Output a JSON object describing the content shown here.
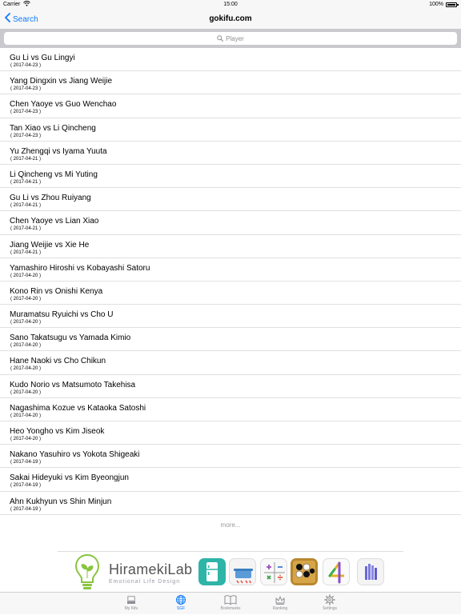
{
  "status": {
    "carrier": "Carrier",
    "time": "15:00",
    "battery": "100%"
  },
  "nav": {
    "back_label": "Search",
    "title": "gokifu.com"
  },
  "search": {
    "placeholder": "Player"
  },
  "games": [
    {
      "title": "Gu Li vs Gu Lingyi",
      "date": "( 2017-04-23 )"
    },
    {
      "title": "Yang Dingxin vs Jiang Weijie",
      "date": "( 2017-04-23 )"
    },
    {
      "title": "Chen Yaoye vs Guo Wenchao",
      "date": "( 2017-04-23 )"
    },
    {
      "title": "Tan Xiao vs Li Qincheng",
      "date": "( 2017-04-23 )"
    },
    {
      "title": "Yu Zhengqi vs Iyama Yuuta",
      "date": "( 2017-04-21 )"
    },
    {
      "title": "Li Qincheng vs Mi Yuting",
      "date": "( 2017-04-21 )"
    },
    {
      "title": "Gu Li vs Zhou Ruiyang",
      "date": "( 2017-04-21 )"
    },
    {
      "title": "Chen Yaoye vs Lian Xiao",
      "date": "( 2017-04-21 )"
    },
    {
      "title": "Jiang Weijie vs Xie He",
      "date": "( 2017-04-21 )"
    },
    {
      "title": "Yamashiro Hiroshi vs Kobayashi Satoru",
      "date": "( 2017-04-20 )"
    },
    {
      "title": "Kono Rin vs Onishi Kenya",
      "date": "( 2017-04-20 )"
    },
    {
      "title": "Muramatsu Ryuichi vs Cho U",
      "date": "( 2017-04-20 )"
    },
    {
      "title": "Sano Takatsugu vs Yamada Kimio",
      "date": "( 2017-04-20 )"
    },
    {
      "title": "Hane Naoki vs Cho Chikun",
      "date": "( 2017-04-20 )"
    },
    {
      "title": "Kudo Norio vs Matsumoto Takehisa",
      "date": "( 2017-04-20 )"
    },
    {
      "title": "Nagashima Kozue vs Kataoka Satoshi",
      "date": "( 2017-04-20 )"
    },
    {
      "title": "Heo Yongho vs Kim Jiseok",
      "date": "( 2017-04-20 )"
    },
    {
      "title": "Nakano Yasuhiro vs Yokota Shigeaki",
      "date": "( 2017-04-19 )"
    },
    {
      "title": "Sakai Hideyuki vs Kim Byeongjun",
      "date": "( 2017-04-19 )"
    },
    {
      "title": "Ahn Kukhyun vs Shin Minjun",
      "date": "( 2017-04-19 )"
    }
  ],
  "more_label": "more...",
  "ad": {
    "brand": "HiramekiLab",
    "tagline": "Emotional Life Design",
    "icons": [
      "fridge-app-icon",
      "pot-app-icon",
      "calculator-app-icon",
      "go-board-app-icon",
      "number-four-app-icon",
      "bars-app-icon"
    ]
  },
  "tabs": [
    {
      "label": "My Kifu",
      "icon": "inbox-icon"
    },
    {
      "label": "SGF",
      "icon": "globe-icon"
    },
    {
      "label": "Bookmarks",
      "icon": "book-icon"
    },
    {
      "label": "Ranking",
      "icon": "crown-icon"
    },
    {
      "label": "Settings",
      "icon": "gear-icon"
    }
  ],
  "colors": {
    "accent": "#0a7aff",
    "bar_background": "#f7f7f7",
    "search_bar_background": "#c9c9ce"
  }
}
